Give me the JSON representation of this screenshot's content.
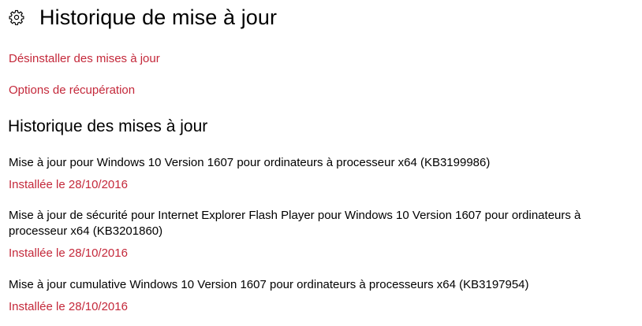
{
  "header": {
    "icon": "gear-icon",
    "title": "Historique de mise à jour"
  },
  "links": {
    "uninstall": "Désinstaller des mises à jour",
    "recovery": "Options de récupération"
  },
  "section": {
    "title": "Historique des mises à jour"
  },
  "updates": [
    {
      "name": "Mise à jour pour Windows 10 Version 1607 pour ordinateurs à processeur x64 (KB3199986)",
      "status": "Installée le 28/10/2016"
    },
    {
      "name": "Mise à jour de sécurité pour Internet Explorer Flash Player pour Windows 10 Version 1607 pour ordinateurs à processeur x64 (KB3201860)",
      "status": "Installée le 28/10/2016"
    },
    {
      "name": "Mise à jour cumulative Windows 10 Version 1607 pour ordinateurs à processeurs x64 (KB3197954)",
      "status": "Installée le 28/10/2016"
    }
  ],
  "colors": {
    "accent": "#c4283a",
    "text": "#000000",
    "background": "#ffffff"
  }
}
